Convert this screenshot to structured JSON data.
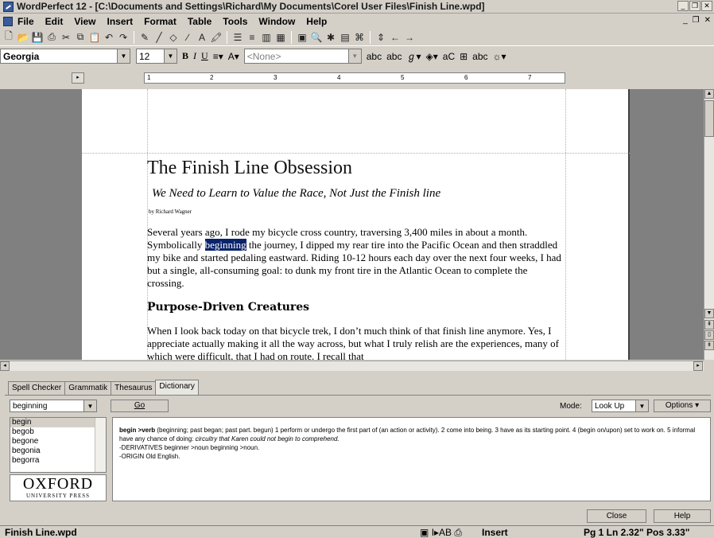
{
  "window": {
    "title": "WordPerfect 12 - [C:\\Documents and Settings\\Richard\\My Documents\\Corel User Files\\Finish Line.wpd]"
  },
  "menu": [
    "File",
    "Edit",
    "View",
    "Insert",
    "Format",
    "Table",
    "Tools",
    "Window",
    "Help"
  ],
  "font": {
    "name": "Georgia",
    "size": "12",
    "style": "<None>"
  },
  "format_buttons": {
    "bold": "B",
    "italic": "I",
    "underline": "U"
  },
  "ruler": {
    "marks": [
      "1",
      "2",
      "3",
      "4",
      "5",
      "6",
      "7"
    ]
  },
  "document": {
    "title": "The Finish Line Obsession",
    "subtitle": "We Need to Learn to Value the Race, Not Just the Finish line",
    "byline": "by Richard Wagner",
    "para1_before": "Several years ago, I rode my bicycle cross country, traversing 3,400 miles in about a month. Symbolically ",
    "para1_highlight": "beginning",
    "para1_after": " the journey, I dipped my rear tire into the Pacific Ocean and then straddled my bike and started pedaling eastward. Riding 10-12 hours each day over the next four weeks, I had but a single, all-consuming goal: to dunk my front tire in the Atlantic Ocean to complete the crossing.",
    "heading": "Purpose-Driven Creatures",
    "para2": "When I look back today on that bicycle trek, I don’t much think of that finish line anymore. Yes, I appreciate actually making it all the way across, but what I truly relish are the experiences, many of which were difficult, that I had on route. I recall that"
  },
  "dictionary": {
    "tabs": [
      "Spell Checker",
      "Grammatik",
      "Thesaurus",
      "Dictionary"
    ],
    "lookup": "beginning",
    "go_label": "Go",
    "mode_label": "Mode:",
    "mode_value": "Look Up",
    "options_label": "Options",
    "words": [
      "begin",
      "begob",
      "begone",
      "begonia",
      "begorra"
    ],
    "publisher": {
      "line1": "OXFORD",
      "line2": "UNIVERSITY PRESS"
    },
    "definition": {
      "headword": "begin >verb",
      "inflections": "(beginning; past began; past part. begun)",
      "senses": "1 perform or undergo the first part of (an action or activity). 2 come into being. 3 have as its starting point. 4 (begin on/upon) set to work on. 5 informal have any chance of doing:",
      "example": "circuitry that Karen could not begin to comprehend.",
      "derivatives": "-DERIVATIVES beginner >noun beginning >noun.",
      "origin": "-ORIGIN Old English."
    },
    "close_label": "Close",
    "help_label": "Help"
  },
  "status": {
    "filename": "Finish Line.wpd",
    "mode": "Insert",
    "position": "Pg 1 Ln 2.32\" Pos 3.33\""
  }
}
